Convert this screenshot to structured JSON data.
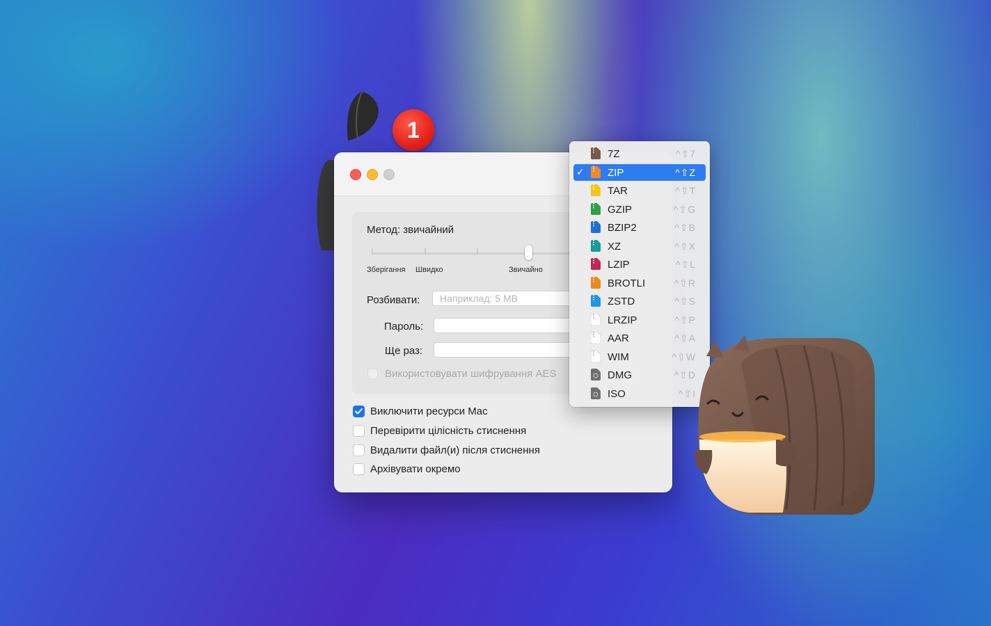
{
  "desktop": {
    "badge_count": "1"
  },
  "window": {
    "method_label": "Метод: звичайний",
    "slider": {
      "ticks": [
        "Зберігання",
        "Швидко",
        "Звичайно"
      ],
      "level": "Звичайно"
    },
    "split_label": "Розбивати:",
    "split_placeholder": "Наприклад: 5 MB",
    "password_label": "Пароль:",
    "repeat_label": "Ще раз:",
    "aes_label": "Використовувати шифрування AES",
    "options": [
      {
        "label": "Виключити ресурси Mac",
        "checked": true
      },
      {
        "label": "Перевірити цілісність стиснення",
        "checked": false
      },
      {
        "label": "Видалити файл(и) після стиснення",
        "checked": false
      },
      {
        "label": "Архівувати окремо",
        "checked": false
      }
    ]
  },
  "format_menu": {
    "checkmark": "✓",
    "items": [
      {
        "label": "7Z",
        "shortcut": "^⇧7",
        "color": "#7a5a4a"
      },
      {
        "label": "ZIP",
        "shortcut": "^⇧Z",
        "color": "#f08a24",
        "selected": true
      },
      {
        "label": "TAR",
        "shortcut": "^⇧T",
        "color": "#f5c518"
      },
      {
        "label": "GZIP",
        "shortcut": "^⇧G",
        "color": "#2e9e4a"
      },
      {
        "label": "BZIP2",
        "shortcut": "^⇧B",
        "color": "#1f6fd1"
      },
      {
        "label": "XZ",
        "shortcut": "^⇧X",
        "color": "#1a9a9a"
      },
      {
        "label": "LZIP",
        "shortcut": "^⇧L",
        "color": "#c2275a"
      },
      {
        "label": "BROTLI",
        "shortcut": "^⇧R",
        "color": "#ee8a1c"
      },
      {
        "label": "ZSTD",
        "shortcut": "^⇧S",
        "color": "#2196e3"
      },
      {
        "label": "LRZIP",
        "shortcut": "^⇧P",
        "color": "#d8d8d8"
      },
      {
        "label": "AAR",
        "shortcut": "^⇧A",
        "color": "#d8d8d8"
      },
      {
        "label": "WIM",
        "shortcut": "^⇧W",
        "color": "#d8d8d8"
      },
      {
        "label": "DMG",
        "shortcut": "^⇧D",
        "color": "#6f6f6f"
      },
      {
        "label": "ISO",
        "shortcut": "^⇧I",
        "color": "#6f6f6f"
      }
    ]
  }
}
